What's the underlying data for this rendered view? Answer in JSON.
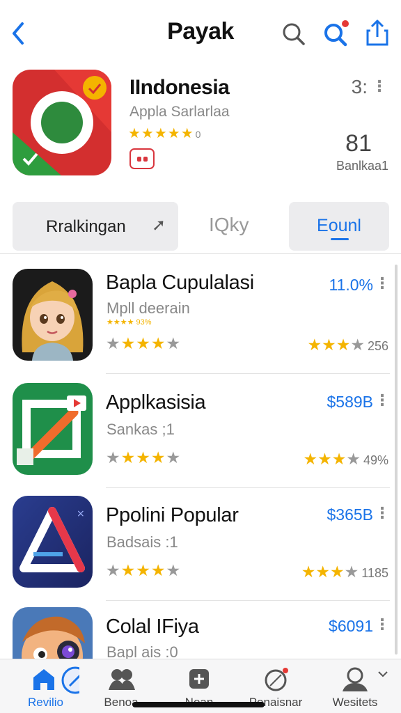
{
  "header": {
    "title": "Payak",
    "back_icon": "chevron-left-icon",
    "search_icon": "search-icon",
    "search_alert_icon": "search-notification-icon",
    "share_icon": "share-icon"
  },
  "featured": {
    "name": "IIndonesia",
    "subtitle": "Appla Sarlarlaa",
    "stars": "★★★★★",
    "stars_suffix": "0",
    "badge_icon": "video-badge-icon",
    "top_value": "3:",
    "count": "81",
    "caption": "Banlkaa1"
  },
  "tabs": [
    {
      "label": "Rralkingan",
      "icon": "arrow-icon"
    },
    {
      "label": "IQky"
    },
    {
      "label": "Eounl",
      "active": true
    }
  ],
  "list": [
    {
      "name": "Bapla Cupulalasi",
      "subtitle": "Mpll deerain",
      "mini_rating": "★★★★ 93%",
      "stars_left": [
        "g",
        "y",
        "y",
        "y",
        "g"
      ],
      "price": "11.0%",
      "stars_right": [
        "y",
        "y",
        "y",
        "g"
      ],
      "count": "256",
      "icon": "girl-avatar-app-icon"
    },
    {
      "name": "Applkasisia",
      "subtitle": "Sankas ;1",
      "stars_left": [
        "g",
        "y",
        "y",
        "y",
        "g"
      ],
      "price": "$589B",
      "stars_right": [
        "y",
        "y",
        "y",
        "g"
      ],
      "count": "49%",
      "icon": "arrow-frame-app-icon"
    },
    {
      "name": "Ppolini Popular",
      "subtitle": "Badsais :1",
      "stars_left": [
        "g",
        "y",
        "y",
        "y",
        "g"
      ],
      "price": "$365B",
      "stars_right": [
        "y",
        "y",
        "y",
        "g"
      ],
      "count": "1185",
      "icon": "triangle-logo-app-icon"
    },
    {
      "name": "Colal IFiya",
      "subtitle": "Bapl ais :0",
      "price": "$6091",
      "icon": "cartoon-character-app-icon"
    }
  ],
  "bottom_nav": [
    {
      "label": "Revilio",
      "icon": "home-icon",
      "active": true
    },
    {
      "label": "Benoa",
      "icon": "people-icon"
    },
    {
      "label": "Nean",
      "icon": "plus-square-icon"
    },
    {
      "label": "Ponaisnar",
      "icon": "notification-ring-icon"
    },
    {
      "label": "Wesitets",
      "icon": "profile-icon"
    }
  ],
  "colors": {
    "accent": "#1a73e8",
    "star": "#f4b400",
    "badge": "#d9363e"
  }
}
